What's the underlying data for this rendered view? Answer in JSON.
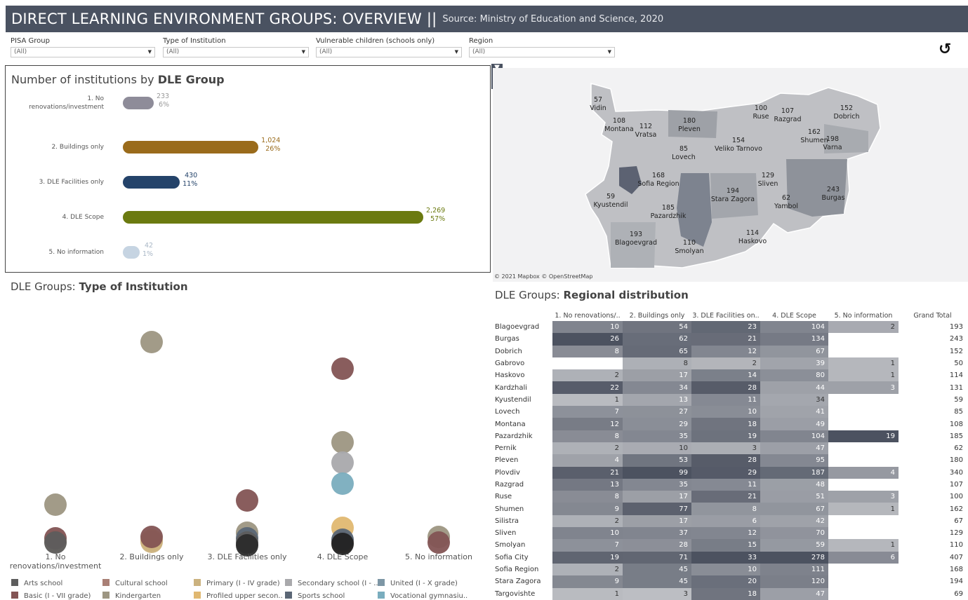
{
  "header": {
    "title": "DIRECT LEARNING ENVIRONMENT GROUPS: OVERVIEW ||",
    "source": "Source: Ministry of Education and Science, 2020"
  },
  "filters": [
    {
      "label": "PISA Group",
      "value": "(All)"
    },
    {
      "label": "Type of Institution",
      "value": "(All)"
    },
    {
      "label": "Vulnerable children (schools only)",
      "value": "(All)"
    },
    {
      "label": "Region",
      "value": "(All)"
    }
  ],
  "reset_icon": "undo-icon",
  "bar_chart": {
    "title_plain": "Number of institutions by ",
    "title_bold": "DLE Group"
  },
  "chart_data": [
    {
      "type": "bar",
      "orientation": "horizontal",
      "categories": [
        "1. No renovations/investment",
        "2. Buildings only",
        "3. DLE Facilities only",
        "4. DLE Scope",
        "5. No information"
      ],
      "values": [
        233,
        1024,
        430,
        2269,
        42
      ],
      "value_labels": [
        "233",
        "1,024",
        "430",
        "2,269",
        "42"
      ],
      "percent_labels": [
        "6%",
        "26%",
        "11%",
        "57%",
        "1%"
      ],
      "colors": [
        "#8e8c99",
        "#9a6b1b",
        "#24436a",
        "#6b7a10",
        "#c6d4e2"
      ]
    },
    {
      "type": "scatter",
      "title_plain": "DLE Groups: ",
      "title_bold": "Type of Institution",
      "categories": [
        "1. No renovations/investment",
        "2. Buildings only",
        "3. DLE Facilities only",
        "4. DLE Scope",
        "5. No information"
      ],
      "legend": [
        {
          "name": "Arts school",
          "color": "#5d5d5d"
        },
        {
          "name": "Cultural school",
          "color": "#a98076"
        },
        {
          "name": "Primary (I - IV grade)",
          "color": "#cbb27f"
        },
        {
          "name": "Secondary school (I - ..",
          "color": "#a9a9ac"
        },
        {
          "name": "United (I - X grade)",
          "color": "#7d96a5"
        },
        {
          "name": "Basic (I - VII grade)",
          "color": "#835454"
        },
        {
          "name": "Kindergarten",
          "color": "#9d9682"
        },
        {
          "name": "Profiled upper secon..",
          "color": "#e0b871"
        },
        {
          "name": "Sports school",
          "color": "#5b6776"
        },
        {
          "name": "Vocational gymnasiu..",
          "color": "#7aadbe"
        }
      ]
    },
    {
      "type": "table",
      "title_plain": "DLE Groups: ",
      "title_bold": "Regional distribution",
      "columns": [
        "1. No renovations/..",
        "2. Buildings only",
        "3. DLE Facilities on..",
        "4. DLE Scope",
        "5. No information",
        "Grand Total"
      ],
      "rows": [
        [
          "Blagoevgrad",
          "10",
          "54",
          "23",
          "104",
          "2",
          "193"
        ],
        [
          "Burgas",
          "26",
          "62",
          "21",
          "134",
          "",
          "243"
        ],
        [
          "Dobrich",
          "8",
          "65",
          "12",
          "67",
          "",
          "152"
        ],
        [
          "Gabrovo",
          "",
          "8",
          "2",
          "39",
          "1",
          "50"
        ],
        [
          "Haskovo",
          "2",
          "17",
          "14",
          "80",
          "1",
          "114"
        ],
        [
          "Kardzhali",
          "22",
          "34",
          "28",
          "44",
          "3",
          "131"
        ],
        [
          "Kyustendil",
          "1",
          "13",
          "11",
          "34",
          "",
          "59"
        ],
        [
          "Lovech",
          "7",
          "27",
          "10",
          "41",
          "",
          "85"
        ],
        [
          "Montana",
          "12",
          "29",
          "18",
          "49",
          "",
          "108"
        ],
        [
          "Pazardzhik",
          "8",
          "35",
          "19",
          "104",
          "19",
          "185"
        ],
        [
          "Pernik",
          "2",
          "10",
          "3",
          "47",
          "",
          "62"
        ],
        [
          "Pleven",
          "4",
          "53",
          "28",
          "95",
          "",
          "180"
        ],
        [
          "Plovdiv",
          "21",
          "99",
          "29",
          "187",
          "4",
          "340"
        ],
        [
          "Razgrad",
          "13",
          "35",
          "11",
          "48",
          "",
          "107"
        ],
        [
          "Ruse",
          "8",
          "17",
          "21",
          "51",
          "3",
          "100"
        ],
        [
          "Shumen",
          "9",
          "77",
          "8",
          "67",
          "1",
          "162"
        ],
        [
          "Silistra",
          "2",
          "17",
          "6",
          "42",
          "",
          "67"
        ],
        [
          "Sliven",
          "10",
          "37",
          "12",
          "70",
          "",
          "129"
        ],
        [
          "Smolyan",
          "7",
          "28",
          "15",
          "59",
          "1",
          "110"
        ],
        [
          "Sofia City",
          "19",
          "71",
          "33",
          "278",
          "6",
          "407"
        ],
        [
          "Sofia Region",
          "2",
          "45",
          "10",
          "111",
          "",
          "168"
        ],
        [
          "Stara Zagora",
          "9",
          "45",
          "20",
          "120",
          "",
          "194"
        ],
        [
          "Targovishte",
          "1",
          "3",
          "18",
          "47",
          "",
          "69"
        ]
      ]
    }
  ],
  "map": {
    "copyright": "© 2021 Mapbox © OpenStreetMap",
    "labels": [
      [
        "57",
        "Vidin"
      ],
      [
        "108",
        "Montana"
      ],
      [
        "112",
        "Vratsa"
      ],
      [
        "180",
        "Pleven"
      ],
      [
        "100",
        "Ruse"
      ],
      [
        "107",
        "Razgrad"
      ],
      [
        "152",
        "Dobrich"
      ],
      [
        "162",
        "Shumen"
      ],
      [
        "198",
        "Varna"
      ],
      [
        "154",
        "Veliko Tarnovo"
      ],
      [
        "85",
        "Lovech"
      ],
      [
        "168",
        "Sofia Region"
      ],
      [
        "129",
        "Sliven"
      ],
      [
        "243",
        "Burgas"
      ],
      [
        "62",
        "Yambol"
      ],
      [
        "194",
        "Stara Zagora"
      ],
      [
        "59",
        "Kyustendil"
      ],
      [
        "185",
        "Pazardzhik"
      ],
      [
        "193",
        "Blagoevgrad"
      ],
      [
        "110",
        "Smolyan"
      ],
      [
        "114",
        "Haskovo"
      ]
    ]
  }
}
